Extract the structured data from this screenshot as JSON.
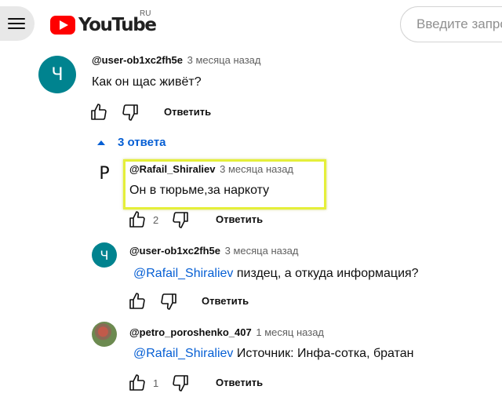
{
  "header": {
    "logo_text": "YouTube",
    "region": "RU",
    "search_placeholder": "Введите запрос"
  },
  "comment": {
    "avatar_letter": "Ч",
    "avatar_color": "#00838f",
    "author": "@user-ob1xc2fh5e",
    "time": "3 месяца назад",
    "text": "Как он щас живёт?",
    "reply_label": "Ответить",
    "replies_toggle": "3 ответа"
  },
  "replies": [
    {
      "avatar_letter": "Р",
      "author": "@Rafail_Shiraliev",
      "time": "3 месяца назад",
      "text": "Он в тюрьме,за наркоту",
      "likes": "2",
      "reply_label": "Ответить"
    },
    {
      "avatar_letter": "Ч",
      "avatar_color": "#00838f",
      "author": "@user-ob1xc2fh5e",
      "time": "3 месяца назад",
      "mention": "@Rafail_Shiraliev",
      "text": " пиздец, а откуда информация?",
      "reply_label": "Ответить"
    },
    {
      "author": "@petro_poroshenko_407",
      "time": "1 месяц назад",
      "mention": "@Rafail_Shiraliev",
      "text": " Источник: Инфа-сотка, братан",
      "likes": "1",
      "reply_label": "Ответить"
    }
  ],
  "highlight_color": "#e5ef3a",
  "icons": [
    "menu-icon",
    "youtube-logo-icon",
    "like-icon",
    "dislike-icon",
    "caret-up-icon"
  ]
}
